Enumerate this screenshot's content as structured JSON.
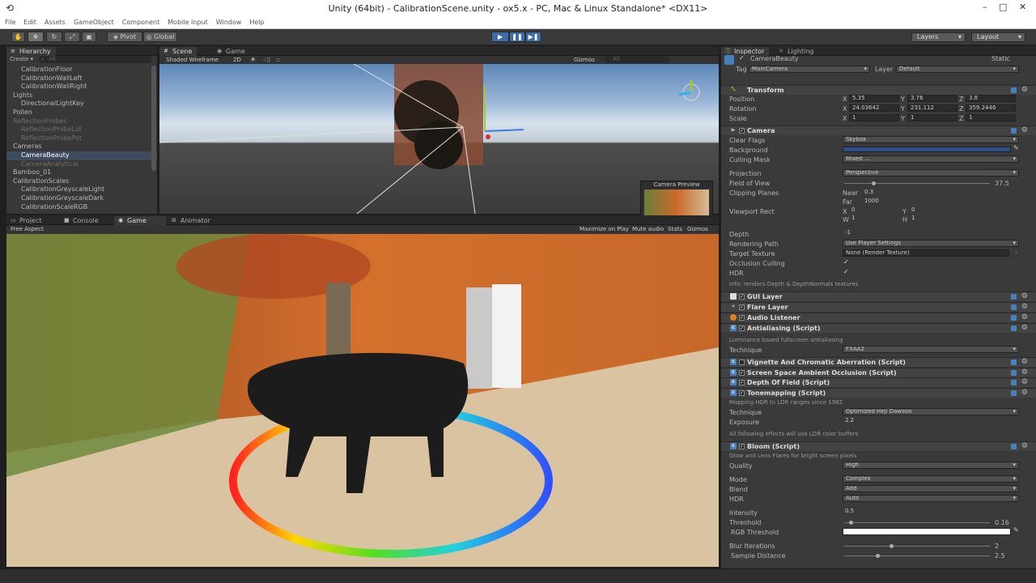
{
  "window": {
    "title": "Unity (64bit) - CalibrationScene.unity - ox5.x - PC, Mac & Linux Standalone* <DX11>",
    "minimize": "–",
    "maximize": "□",
    "close": "✕"
  },
  "menu": [
    "File",
    "Edit",
    "Assets",
    "GameObject",
    "Component",
    "Mobile Input",
    "Window",
    "Help"
  ],
  "toolbar": {
    "pivot": "Pivot",
    "global": "Global",
    "layers": "Layers",
    "layout": "Layout"
  },
  "hierarchy": {
    "tab": "Hierarchy",
    "create": "Create",
    "search_placeholder": "All",
    "items": [
      {
        "label": "CalibrationFloor",
        "indent": 2
      },
      {
        "label": "CalibrationWallLeft",
        "indent": 2
      },
      {
        "label": "CalibrationWallRight",
        "indent": 2
      },
      {
        "label": "Lights",
        "indent": 1
      },
      {
        "label": "DirectionalLightKey",
        "indent": 2
      },
      {
        "label": "Pollen",
        "indent": 1
      },
      {
        "label": "ReflectionProbes",
        "indent": 1,
        "dim": true
      },
      {
        "label": "ReflectionProbeLid",
        "indent": 2,
        "dim": true
      },
      {
        "label": "ReflectionProbePot",
        "indent": 2,
        "dim": true
      },
      {
        "label": "Cameras",
        "indent": 1
      },
      {
        "label": "CameraBeauty",
        "indent": 2,
        "selected": true
      },
      {
        "label": "CameraAnalytical",
        "indent": 2,
        "dim": true
      },
      {
        "label": "Bamboo_01",
        "indent": 1
      },
      {
        "label": "CalibrationScales",
        "indent": 1
      },
      {
        "label": "CalibrationGreyscaleLight",
        "indent": 2
      },
      {
        "label": "CalibrationGreyscaleDark",
        "indent": 2
      },
      {
        "label": "CalibrationScaleRGB",
        "indent": 2
      }
    ]
  },
  "scene": {
    "tab_scene": "Scene",
    "tab_game": "Game",
    "shading": "Shaded Wireframe",
    "mode2d": "2D",
    "gizmos": "Gizmos",
    "search_placeholder": "All",
    "camera_preview": "Camera Preview"
  },
  "bottom_tabs": {
    "project": "Project",
    "console": "Console",
    "game": "Game",
    "animator": "Animator"
  },
  "game": {
    "aspect": "Free Aspect",
    "maximize": "Maximize on Play",
    "mute": "Mute audio",
    "stats": "Stats",
    "gizmos": "Gizmos"
  },
  "inspector": {
    "tab": "Inspector",
    "tab_lighting": "Lighting",
    "object_name": "CameraBeauty",
    "static": "Static",
    "tag_label": "Tag",
    "tag": "MainCamera",
    "layer_label": "Layer",
    "layer": "Default",
    "transform": {
      "title": "Transform",
      "position": "Position",
      "rotation": "Rotation",
      "scale": "Scale",
      "pos": [
        "5.35",
        "3.76",
        "3.8"
      ],
      "rot": [
        "24.03642",
        "231.112",
        "359.2446"
      ],
      "scl": [
        "1",
        "1",
        "1"
      ],
      "axes": [
        "X",
        "Y",
        "Z"
      ]
    },
    "camera": {
      "title": "Camera",
      "clear_flags": "Clear Flags",
      "clear_flags_val": "Skybox",
      "background": "Background",
      "culling": "Culling Mask",
      "culling_val": "Mixed ...",
      "projection": "Projection",
      "projection_val": "Perspective",
      "fov": "Field of View",
      "fov_val": "37.5",
      "clipping": "Clipping Planes",
      "near": "Near",
      "near_val": "0.3",
      "far": "Far",
      "far_val": "1000",
      "viewport": "Viewport Rect",
      "vx": "0",
      "vy": "0",
      "vw": "1",
      "vh": "1",
      "depth": "Depth",
      "depth_val": "-1",
      "rendering_path": "Rendering Path",
      "rendering_path_val": "Use Player Settings",
      "target_tex": "Target Texture",
      "target_tex_val": "None (Render Texture)",
      "occlusion": "Occlusion Culling",
      "hdr": "HDR",
      "info": "Info: renders Depth & DepthNormals textures",
      "bg_color": "#2a4f8a"
    },
    "components": [
      "GUI Layer",
      "Flare Layer",
      "Audio Listener"
    ],
    "antialiasing": {
      "title": "Antialiasing (Script)",
      "note": "Luminance based fullscreen antialiasing",
      "technique": "Technique",
      "technique_val": "FXAA2"
    },
    "vignette": "Vignette And Chromatic Aberration (Script)",
    "ssao": "Screen Space Ambient Occlusion (Script)",
    "dof": "Depth Of Field (Script)",
    "tonemapping": {
      "title": "Tonemapping (Script)",
      "note": "Mapping HDR to LDR ranges since 1982",
      "technique": "Technique",
      "technique_val": "Optimized Hejl Dawson",
      "exposure": "Exposure",
      "exposure_val": "2.2",
      "note2": "All following effects will use LDR color buffers"
    },
    "bloom": {
      "title": "Bloom (Script)",
      "note": "Glow and Lens Flares for bright screen pixels",
      "quality": "Quality",
      "quality_val": "High",
      "mode": "Mode",
      "mode_val": "Complex",
      "blend": "Blend",
      "blend_val": "Add",
      "hdr": "HDR",
      "hdr_val": "Auto",
      "intensity": "Intensity",
      "intensity_val": "0.5",
      "threshold": "Threshold",
      "threshold_val": "0.16",
      "rgb_threshold": "RGB Threshold",
      "blur": "Blur Iterations",
      "blur_val": "2",
      "sample": "Sample Distance",
      "sample_val": "2.5"
    }
  }
}
